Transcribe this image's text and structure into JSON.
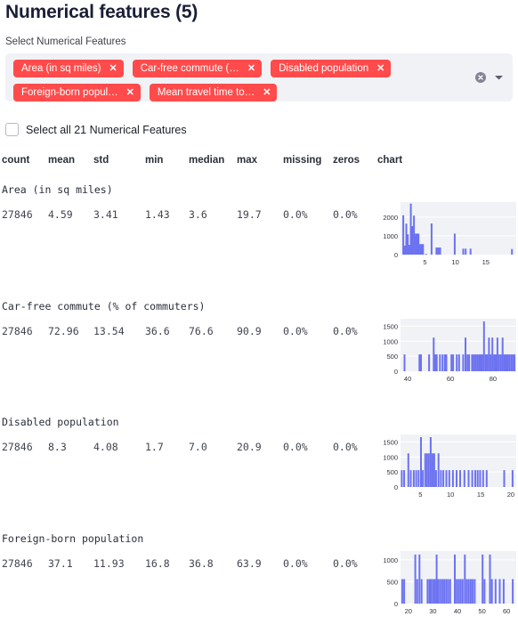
{
  "header": {
    "title": "Numerical features (5)"
  },
  "select": {
    "label": "Select Numerical Features",
    "pills": [
      {
        "label": "Area (in sq miles)",
        "remove": "✕"
      },
      {
        "label": "Car-free commute (…",
        "remove": "✕"
      },
      {
        "label": "Disabled population",
        "remove": "✕"
      },
      {
        "label": "Foreign-born popul…",
        "remove": "✕"
      },
      {
        "label": "Mean travel time to…",
        "remove": "✕"
      }
    ],
    "clear_icon": "clear-all-icon",
    "dropdown_icon": "chevron-down-icon",
    "pill_color": "#ff4b4b",
    "field_bg": "#f0f2f6"
  },
  "select_all": {
    "label": "Select all 21 Numerical Features",
    "checked": false
  },
  "table": {
    "columns": [
      "count",
      "mean",
      "std",
      "min",
      "median",
      "max",
      "missing",
      "zeros",
      "chart"
    ],
    "rows": [
      {
        "feature": "Area (in sq miles)",
        "count": "27846",
        "mean": "4.59",
        "std": "3.41",
        "min": "1.43",
        "median": "3.6",
        "max": "19.7",
        "missing": "0.0%",
        "zeros": "0.0%"
      },
      {
        "feature": "Car-free commute (% of commuters)",
        "count": "27846",
        "mean": "72.96",
        "std": "13.54",
        "min": "36.6",
        "median": "76.6",
        "max": "90.9",
        "missing": "0.0%",
        "zeros": "0.0%"
      },
      {
        "feature": "Disabled population",
        "count": "27846",
        "mean": "8.3",
        "std": "4.08",
        "min": "1.7",
        "median": "7.0",
        "max": "20.9",
        "missing": "0.0%",
        "zeros": "0.0%"
      },
      {
        "feature": "Foreign-born population",
        "count": "27846",
        "mean": "37.1",
        "std": "11.93",
        "min": "16.8",
        "median": "36.8",
        "max": "63.9",
        "missing": "0.0%",
        "zeros": "0.0%"
      }
    ]
  },
  "chart_data": [
    {
      "type": "bar",
      "title": "Area (in sq miles)",
      "xlabel": "",
      "ylabel": "",
      "bar_color": "#6c72f0",
      "plot_bg": "#f0f2f6",
      "grid": true,
      "xlim": [
        1.0,
        20.0
      ],
      "ylim": [
        0,
        2800
      ],
      "yticks": [
        0,
        1000,
        2000
      ],
      "ytick_labels": [
        "0",
        "1000",
        "2000"
      ],
      "xticks": [
        5,
        10,
        15
      ],
      "xtick_labels": [
        "5",
        "10",
        "15"
      ],
      "x": [
        1.45,
        1.7,
        1.95,
        2.2,
        2.45,
        2.7,
        2.95,
        3.2,
        3.45,
        3.7,
        3.95,
        4.2,
        4.45,
        4.7,
        5.2,
        6.1,
        6.9,
        7.2,
        7.5,
        9.9,
        11.3,
        11.7,
        12.5,
        19.3
      ],
      "values": [
        2100,
        480,
        1650,
        1080,
        520,
        2720,
        1520,
        2080,
        1120,
        1120,
        1120,
        560,
        560,
        560,
        40,
        1660,
        380,
        380,
        380,
        1120,
        320,
        320,
        320,
        300
      ]
    },
    {
      "type": "bar",
      "title": "Car-free commute (% of commuters)",
      "xlabel": "",
      "ylabel": "",
      "bar_color": "#6c72f0",
      "plot_bg": "#f0f2f6",
      "grid": true,
      "xlim": [
        36.6,
        90.9
      ],
      "ylim": [
        0,
        1750
      ],
      "yticks": [
        0,
        500,
        1000,
        1500
      ],
      "ytick_labels": [
        "0",
        "500",
        "1000",
        "1500"
      ],
      "xticks": [
        40,
        60,
        80
      ],
      "xtick_labels": [
        "40",
        "60",
        "80"
      ],
      "x": [
        38.5,
        45.5,
        46.2,
        50.0,
        52.2,
        52.9,
        53.6,
        55.1,
        56.3,
        57.4,
        58.1,
        60.5,
        61.3,
        63.0,
        64.1,
        66.0,
        67.1,
        68.0,
        68.8,
        70.2,
        71.0,
        71.8,
        72.6,
        73.4,
        74.2,
        75.0,
        75.8,
        76.6,
        77.3,
        78.1,
        78.9,
        79.7,
        80.5,
        81.3,
        82.1,
        82.9,
        83.7,
        84.5,
        85.3,
        86.1,
        86.9,
        87.7,
        88.5,
        89.3,
        90.1
      ],
      "values": [
        560,
        560,
        560,
        560,
        1120,
        560,
        560,
        560,
        560,
        560,
        560,
        560,
        560,
        560,
        560,
        560,
        1120,
        560,
        560,
        560,
        560,
        560,
        560,
        560,
        560,
        560,
        1660,
        560,
        560,
        1120,
        560,
        1120,
        560,
        560,
        1120,
        560,
        560,
        1120,
        560,
        560,
        560,
        560,
        560,
        560,
        560
      ]
    },
    {
      "type": "bar",
      "title": "Disabled population",
      "xlabel": "",
      "ylabel": "",
      "bar_color": "#6c72f0",
      "plot_bg": "#f0f2f6",
      "grid": true,
      "xlim": [
        1.7,
        20.9
      ],
      "ylim": [
        0,
        1750
      ],
      "yticks": [
        0,
        500,
        1000,
        1500
      ],
      "ytick_labels": [
        "0",
        "500",
        "1000",
        "1500"
      ],
      "xticks": [
        5,
        10,
        15,
        20
      ],
      "xtick_labels": [
        "5",
        "10",
        "15",
        "20"
      ],
      "x": [
        1.9,
        2.3,
        3.0,
        3.4,
        3.9,
        4.3,
        4.7,
        5.1,
        5.4,
        5.8,
        6.1,
        6.4,
        6.7,
        7.0,
        7.3,
        7.6,
        8.0,
        8.4,
        8.8,
        9.3,
        9.8,
        10.4,
        11.0,
        11.6,
        12.3,
        13.0,
        13.6,
        14.1,
        14.5,
        14.9,
        15.4,
        16.0,
        18.9,
        20.3
      ],
      "values": [
        560,
        560,
        1120,
        560,
        560,
        560,
        560,
        1660,
        560,
        1120,
        1120,
        1120,
        1660,
        1120,
        1120,
        560,
        1120,
        560,
        560,
        560,
        560,
        560,
        560,
        560,
        560,
        560,
        560,
        560,
        560,
        560,
        560,
        560,
        560,
        560
      ]
    },
    {
      "type": "bar",
      "title": "Foreign-born population",
      "xlabel": "",
      "ylabel": "",
      "bar_color": "#6c72f0",
      "plot_bg": "#f0f2f6",
      "grid": true,
      "xlim": [
        16.8,
        63.9
      ],
      "ylim": [
        0,
        1200
      ],
      "yticks": [
        0,
        500,
        1000
      ],
      "ytick_labels": [
        "0",
        "500",
        "1000"
      ],
      "xticks": [
        20,
        30,
        40,
        50,
        60
      ],
      "xtick_labels": [
        "20",
        "30",
        "40",
        "50",
        "60"
      ],
      "x": [
        17.5,
        18.3,
        22.8,
        23.6,
        24.5,
        25.4,
        27.8,
        28.6,
        29.3,
        30.1,
        30.8,
        31.5,
        32.2,
        33.0,
        33.8,
        34.6,
        35.4,
        36.2,
        37.0,
        38.9,
        39.7,
        40.5,
        41.3,
        42.1,
        43.0,
        43.8,
        44.6,
        45.4,
        46.2,
        47.0,
        50.2,
        51.0,
        53.2,
        54.0,
        55.5,
        57.2,
        58.8,
        62.5
      ],
      "values": [
        560,
        560,
        1120,
        560,
        1120,
        560,
        560,
        560,
        560,
        560,
        560,
        1120,
        560,
        560,
        560,
        560,
        560,
        560,
        560,
        1120,
        560,
        560,
        560,
        560,
        1120,
        560,
        560,
        560,
        560,
        560,
        1120,
        560,
        1120,
        560,
        560,
        560,
        560,
        560
      ]
    }
  ]
}
